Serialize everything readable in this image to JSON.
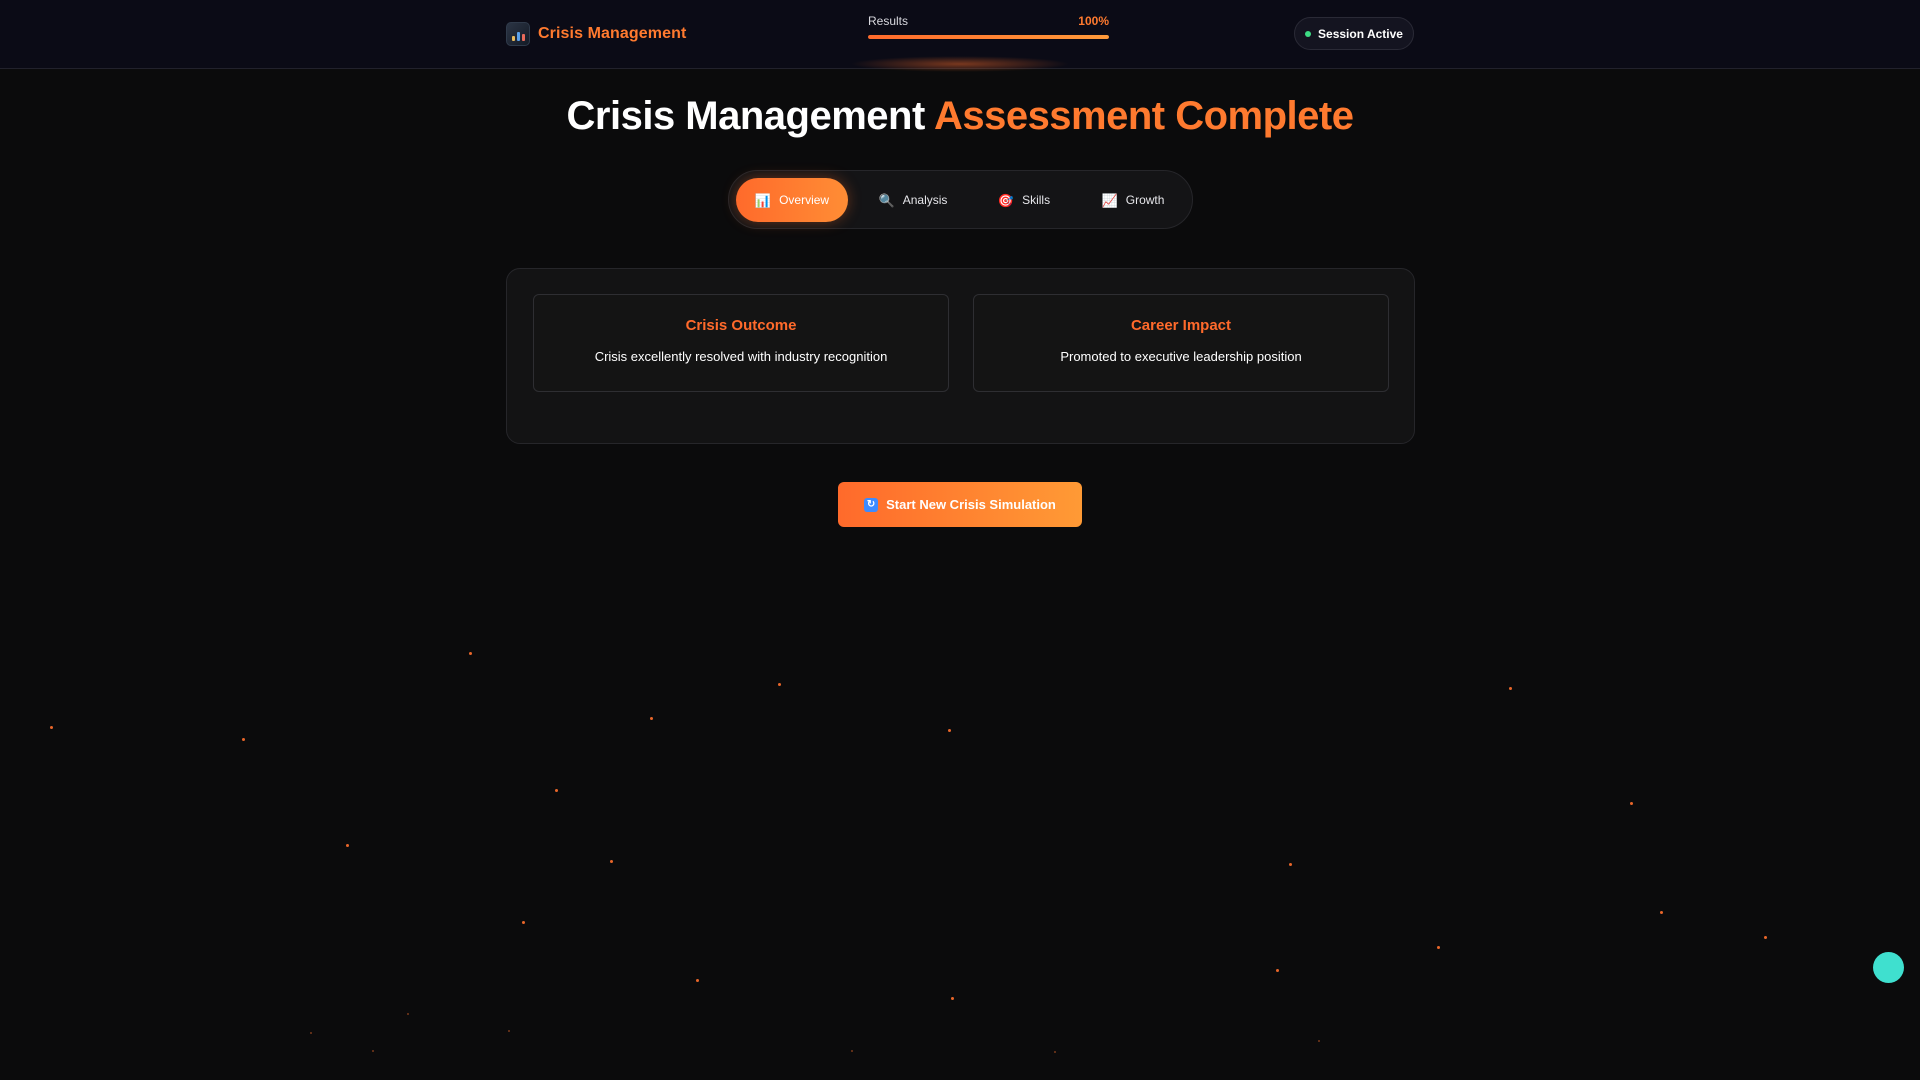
{
  "header": {
    "brand_title": "Crisis Management",
    "brand_icon": "bar-chart-icon",
    "progress": {
      "label": "Results",
      "value_text": "100%",
      "fraction": 1.0
    },
    "session": {
      "label": "Session Active",
      "status_color": "#3ddc84"
    }
  },
  "headline": {
    "part1": "Crisis Management",
    "part2": "Assessment Complete"
  },
  "tabs": [
    {
      "label": "Overview",
      "icon": "bar-chart-icon",
      "glyph": "📊",
      "active": true
    },
    {
      "label": "Analysis",
      "icon": "magnifier-icon",
      "glyph": "🔍",
      "active": false
    },
    {
      "label": "Skills",
      "icon": "target-icon",
      "glyph": "🎯",
      "active": false
    },
    {
      "label": "Growth",
      "icon": "trend-up-icon",
      "glyph": "📈",
      "active": false
    }
  ],
  "cards": [
    {
      "title": "Crisis Outcome",
      "text": "Crisis excellently resolved with industry recognition"
    },
    {
      "title": "Career Impact",
      "text": "Promoted to executive leadership position"
    }
  ],
  "cta": {
    "label": "Start New Crisis Simulation",
    "icon": "refresh-icon",
    "glyph": "🔄"
  },
  "colors": {
    "accent": "#ff7a2f",
    "background": "#0b0b0c",
    "float_button": "#3fe0cf"
  }
}
